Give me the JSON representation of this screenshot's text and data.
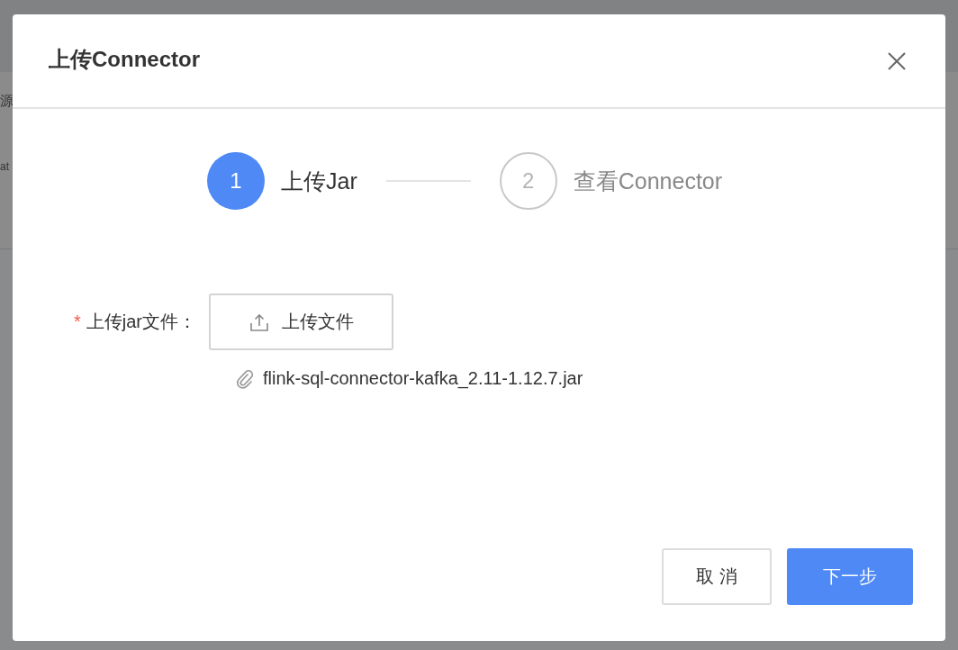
{
  "background": {
    "texts": [
      "源",
      "at"
    ]
  },
  "dialog": {
    "title": "上传Connector",
    "steps": [
      {
        "number": "1",
        "label": "上传Jar",
        "selected": true
      },
      {
        "number": "2",
        "label": "查看Connector",
        "selected": false
      }
    ],
    "form": {
      "label": "上传jar文件：",
      "required_mark": "*",
      "upload_button": "上传文件",
      "files": [
        "flink-sql-connector-kafka_2.11-1.12.7.jar"
      ]
    },
    "buttons": [
      {
        "label": "取 消",
        "kind": "secondary"
      },
      {
        "label": "下一步",
        "kind": "primary"
      }
    ]
  }
}
